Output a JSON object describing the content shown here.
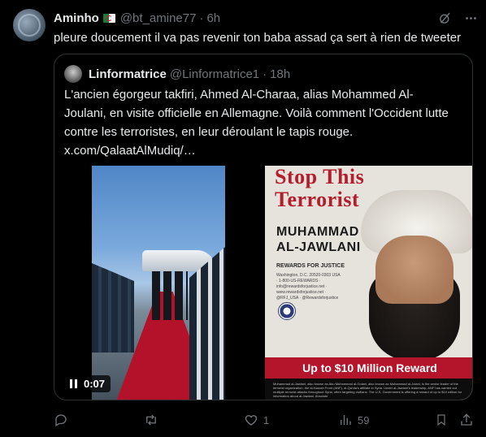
{
  "tweet": {
    "author": {
      "name": "Aminho",
      "flag": "algeria-flag-icon",
      "handle": "@bt_amine77",
      "separator": "·",
      "time": "6h"
    },
    "text": "pleure doucement il va pas revenir ton baba assad ça sert à rien de tweeter",
    "icons": [
      "grok-icon",
      "more-icon"
    ]
  },
  "quote": {
    "author": {
      "name": "Linformatrice",
      "handle": "@Linformatrice1",
      "separator": "·",
      "time": "18h"
    },
    "lines": [
      "L'ancien égorgeur takfiri, Ahmed Al-Charaa, alias Mohammed Al-",
      "Joulani, en visite officielle en Allemagne. Voilà comment l'Occident lutte",
      "contre les terroristes, en leur déroulant le tapis rouge.",
      "x.com/QalaatAlMudiq/…"
    ],
    "video": {
      "timecode": "0:07",
      "state": "playing"
    },
    "poster": {
      "title_line1": "Stop This",
      "title_line2": "Terrorist",
      "name_line1": "MUHAMMAD",
      "name_line2": "AL-JAWLANI",
      "rfj": "REWARDS FOR JUSTICE",
      "contact": "Washington, D.C. 20520-0303 USA · 1-800-US-REWARDS · info@rewardsforjustice.net · www.rewardsforjustice.net · @RFJ_USA · @Rewardsforjustice",
      "reward": "Up to $10 Million Reward",
      "footer": "Muhammad al-Jawlani, also known as Abu Muhammad al-Golani, also known as Muhammad al-Jolani, is the senior leader of the terrorist organization, the al-Nusrah Front (ANF), al-Qa'ida's affiliate in Syria. Under al-Jawlani's leadership, ANF has carried out multiple terrorist attacks throughout Syria, often targeting civilians. The U.S. Government is offering a reward of up to $10 million for information about al-Jawlani. Absolute"
    }
  },
  "actions": {
    "reply": {
      "icon": "reply-icon",
      "count": ""
    },
    "retweet": {
      "icon": "retweet-icon",
      "count": ""
    },
    "like": {
      "icon": "heart-icon",
      "count": "1"
    },
    "views": {
      "icon": "views-icon",
      "count": "59"
    },
    "bookmark": {
      "icon": "bookmark-icon",
      "count": ""
    },
    "share": {
      "icon": "share-icon",
      "count": ""
    }
  },
  "colors": {
    "background": "#000000",
    "text": "#e7e9ea",
    "muted": "#71767b",
    "border": "#2f3336",
    "poster_red": "#b4152a"
  }
}
